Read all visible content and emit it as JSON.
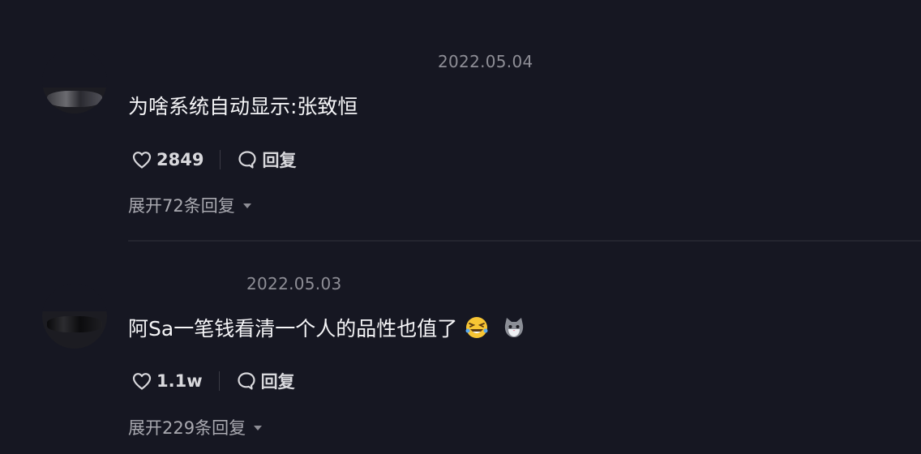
{
  "comments": [
    {
      "date": "2022.05.04",
      "text": "为啥系统自动显示:张致恒",
      "likes": "2849",
      "reply_label": "回复",
      "expand_label": "展开72条回复"
    },
    {
      "date": "2022.05.03",
      "text": "阿Sa一笔钱看清一个人的品性也值了",
      "emojis": [
        "rofl-emoji",
        "cat-emoji"
      ],
      "likes": "1.1w",
      "reply_label": "回复",
      "expand_label": "展开229条回复"
    }
  ],
  "colors": {
    "background": "#161722",
    "text": "#f5f5f7",
    "muted": "#8e8e96",
    "divider": "#24252f"
  },
  "icons": {
    "like": "heart-outline-icon",
    "reply": "speech-bubble-icon",
    "expand": "caret-down-icon"
  }
}
